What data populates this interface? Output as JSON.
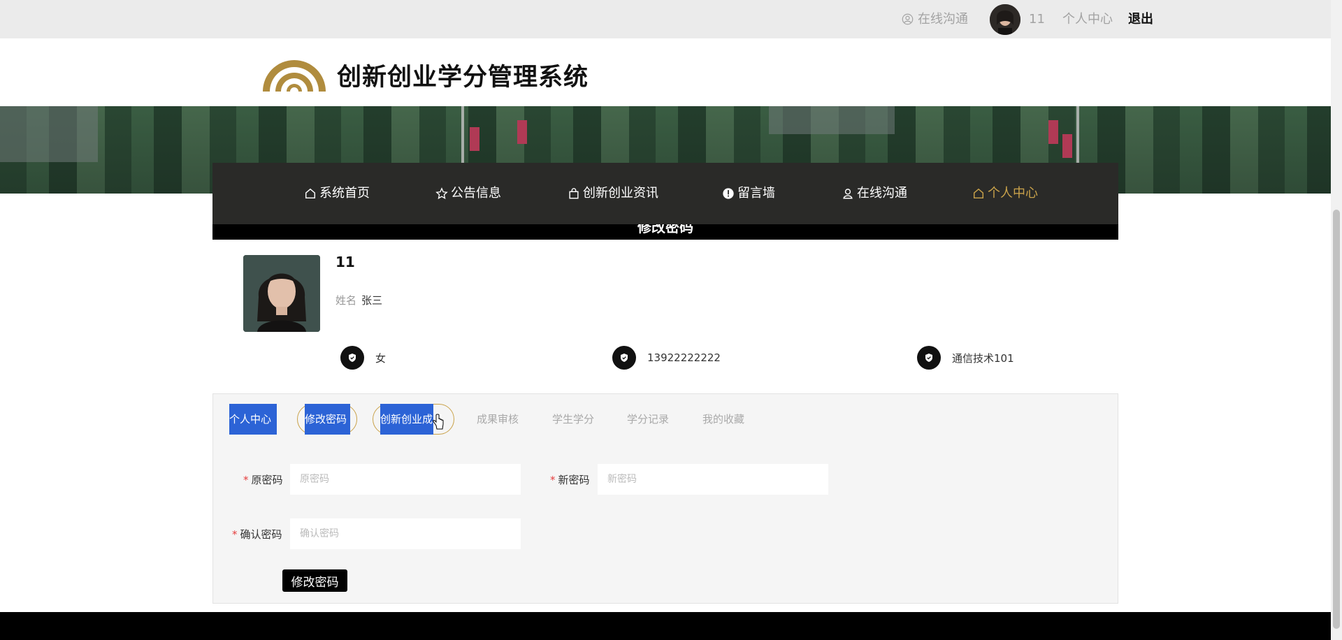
{
  "topbar": {
    "chat_label": "在线沟通",
    "username": "11",
    "personal_center": "个人中心",
    "logout": "退出"
  },
  "header": {
    "site_title": "创新创业学分管理系统"
  },
  "nav": {
    "items": [
      {
        "label": "系统首页",
        "icon": "home-icon"
      },
      {
        "label": "公告信息",
        "icon": "star-icon"
      },
      {
        "label": "创新创业资讯",
        "icon": "bag-icon"
      },
      {
        "label": "留言墙",
        "icon": "alert-icon"
      },
      {
        "label": "在线沟通",
        "icon": "user-icon"
      },
      {
        "label": "个人中心",
        "icon": "home-icon",
        "active": true
      }
    ]
  },
  "strip_title": "修改密码",
  "profile": {
    "username": "11",
    "name_label": "姓名",
    "name_value": "张三",
    "gender": "女",
    "phone": "13922222222",
    "class": "通信技术101"
  },
  "tabs": [
    {
      "label": "个人中心"
    },
    {
      "label": "修改密码"
    },
    {
      "label": "创新创业成果"
    },
    {
      "label": "成果审核"
    },
    {
      "label": "学生学分"
    },
    {
      "label": "学分记录"
    },
    {
      "label": "我的收藏"
    }
  ],
  "form": {
    "old_password": {
      "label": "原密码",
      "placeholder": "原密码"
    },
    "new_password": {
      "label": "新密码",
      "placeholder": "新密码"
    },
    "confirm_password": {
      "label": "确认密码",
      "placeholder": "确认密码"
    },
    "required_mark": "*",
    "submit_label": "修改密码"
  },
  "colors": {
    "accent_gold": "#c9a24a",
    "nav_bg": "#2a2a28",
    "tab_highlight": "#2c63d6"
  }
}
